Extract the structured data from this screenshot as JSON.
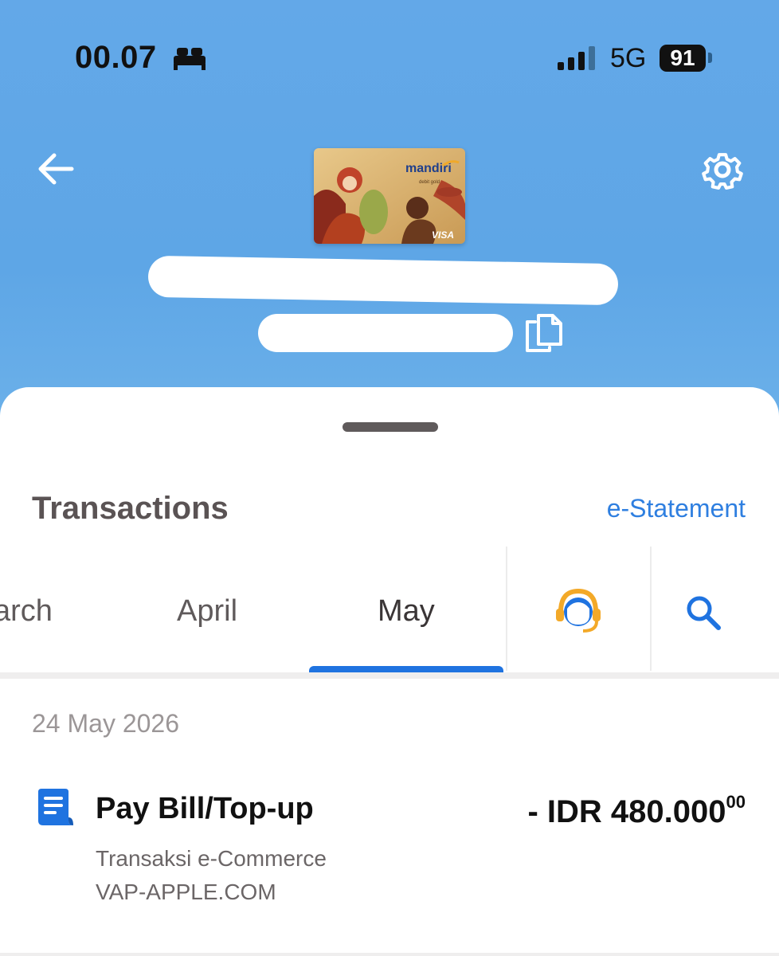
{
  "status_bar": {
    "time": "00.07",
    "network": "5G",
    "battery": "91",
    "icons": [
      "bed-icon",
      "signal-bars-icon",
      "battery-icon"
    ]
  },
  "header": {
    "back_icon": "arrow-left-icon",
    "settings_icon": "gear-icon",
    "copy_icon": "copy-icon",
    "card": {
      "brand": "mandiri",
      "type": "debit gold",
      "network": "VISA"
    }
  },
  "colors": {
    "header_bg": "#5ea6e6",
    "accent": "#1f73e0",
    "link": "#2f7fe0"
  },
  "transactions": {
    "title": "Transactions",
    "e_statement": "e-Statement",
    "tabs": [
      {
        "label": "arch",
        "active": false
      },
      {
        "label": "April",
        "active": false
      },
      {
        "label": "May",
        "active": true
      }
    ],
    "support_icon": "customer-service-icon",
    "search_icon": "search-icon",
    "groups": [
      {
        "date": "24 May 2026",
        "items": [
          {
            "icon": "receipt-icon",
            "title": "Pay Bill/Top-up",
            "amount": "- IDR 480.000",
            "amount_cents": "00",
            "line1": "Transaksi e-Commerce",
            "line2": "VAP-APPLE.COM"
          }
        ]
      }
    ]
  }
}
